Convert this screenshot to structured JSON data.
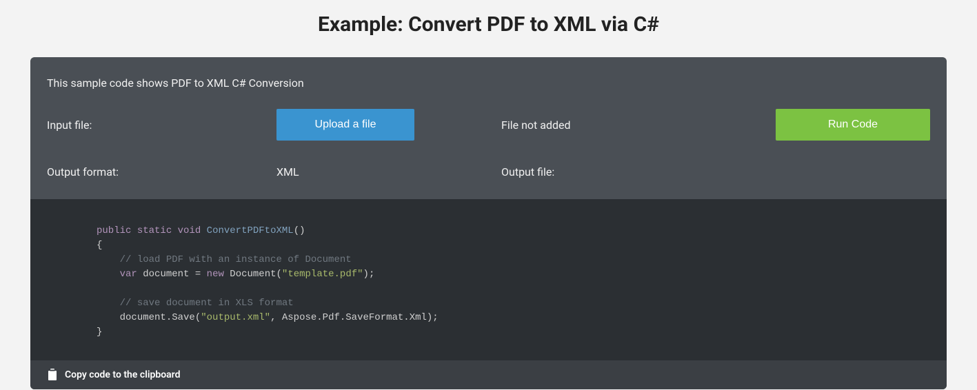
{
  "title": "Example: Convert PDF to XML via C#",
  "panel": {
    "description": "This sample code shows PDF to XML C# Conversion",
    "input_label": "Input file:",
    "upload_label": "Upload a file",
    "file_status": "File not added",
    "run_label": "Run Code",
    "output_format_label": "Output format:",
    "output_format_value": "XML",
    "output_file_label": "Output file:",
    "output_file_value": ""
  },
  "code": {
    "kw1": "public",
    "kw2": "static",
    "kw3": "void",
    "fn_name": "ConvertPDFtoXML",
    "paren_open": "()",
    "brace_open": "{",
    "comment1": "// load PDF with an instance of Document",
    "kw_var": "var",
    "ident_doc": "document",
    "eq": " = ",
    "kw_new": "new",
    "ctor": "Document",
    "str1": "\"template.pdf\"",
    "line_end1": ");",
    "comment2": "// save document in XLS format",
    "save_call_pre": "document.Save(",
    "str2": "\"output.xml\"",
    "save_call_post": ", Aspose.Pdf.SaveFormat.Xml);",
    "brace_close": "}"
  },
  "copy_label": "Copy code to the clipboard"
}
